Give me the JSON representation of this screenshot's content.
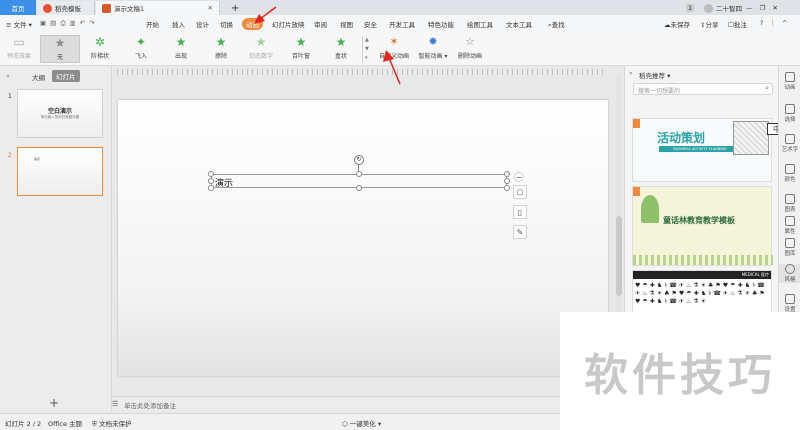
{
  "titlebar": {
    "home_tab": "首页",
    "tabs": [
      {
        "label": "稻壳模板",
        "icon": "wps-logo-icon"
      },
      {
        "label": "演示文稿1",
        "icon": "presentation-file-icon"
      }
    ],
    "add_tab": "+",
    "badge": "1",
    "user_name": "二十智四",
    "window_controls": [
      "—",
      "❐",
      "✕"
    ]
  },
  "menubar": {
    "file_menu": "文件",
    "items": [
      "开始",
      "插入",
      "设计",
      "切换",
      "动画",
      "幻灯片放映",
      "审阅",
      "视图",
      "安全",
      "开发工具",
      "特色功能",
      "绘图工具",
      "文本工具"
    ],
    "active_item": "动画",
    "search": "查找",
    "unsaved": "未保存",
    "share": "分享",
    "comment": "批注"
  },
  "ribbon": {
    "preview": "预览效果",
    "effects": [
      "无",
      "阶梯状",
      "飞入",
      "出现",
      "擦除",
      "劲态数字",
      "百叶窗",
      "盒状"
    ],
    "custom_animation": "自定义动画",
    "smart_animation": "智能动画",
    "delete_animation": "删除动画"
  },
  "leftpanel": {
    "tabs": [
      "大纲",
      "幻灯片"
    ],
    "slides": [
      {
        "number": "1",
        "title": "空白演示",
        "subtitle": "单击输入您的封面副标题"
      },
      {
        "number": "2",
        "title": "演示"
      }
    ],
    "add_slide": "+"
  },
  "canvas": {
    "textbox_text": "演示"
  },
  "notes": {
    "placeholder": "单击此处添加备注"
  },
  "statusbar": {
    "slide_info": "幻灯片 2 / 2",
    "theme": "Office 主题",
    "protect": "文档未保护",
    "beautify": "一键美化"
  },
  "rightpanel": {
    "title": "稻壳推荐",
    "search_placeholder": "搜索一切想要的",
    "cards": [
      {
        "title": "活动策划",
        "subtitle": "BUSINESS ACTIVITY PLANNING",
        "badge": "中"
      },
      {
        "title": "童话林教育教学模板"
      },
      {
        "title": "MEDICAL 医疗"
      }
    ]
  },
  "rightbar": {
    "items": [
      "动画",
      "选择",
      "艺术字",
      "颜色",
      "图表",
      "属性",
      "图库",
      "风格",
      "设置"
    ]
  },
  "watermark": {
    "text": "软件技巧"
  },
  "colors": {
    "accent_orange": "#f08a3d",
    "home_blue": "#3c8fe8",
    "star_green": "#3db34a",
    "arrow_red": "#e0261b"
  }
}
